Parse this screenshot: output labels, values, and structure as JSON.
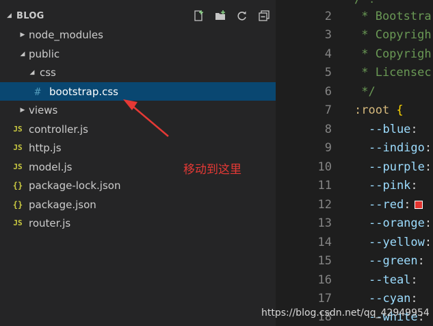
{
  "explorer": {
    "section_title": "BLOG",
    "actions": [
      {
        "name": "new-file-icon"
      },
      {
        "name": "new-folder-icon"
      },
      {
        "name": "refresh-icon"
      },
      {
        "name": "collapse-all-icon"
      }
    ],
    "tree": [
      {
        "label": "node_modules",
        "type": "folder",
        "expanded": false,
        "depth": 1
      },
      {
        "label": "public",
        "type": "folder",
        "expanded": true,
        "depth": 1
      },
      {
        "label": "css",
        "type": "folder",
        "expanded": true,
        "depth": 2
      },
      {
        "label": "bootstrap.css",
        "type": "file",
        "icon": "#",
        "depth": 3,
        "selected": true
      },
      {
        "label": "views",
        "type": "folder",
        "expanded": false,
        "depth": 1
      },
      {
        "label": "controller.js",
        "type": "file",
        "icon": "JS",
        "depth": 0
      },
      {
        "label": "http.js",
        "type": "file",
        "icon": "JS",
        "depth": 0
      },
      {
        "label": "model.js",
        "type": "file",
        "icon": "JS",
        "depth": 0
      },
      {
        "label": "package-lock.json",
        "type": "file",
        "icon": "{}",
        "depth": 0
      },
      {
        "label": "package.json",
        "type": "file",
        "icon": "{}",
        "depth": 0
      },
      {
        "label": "router.js",
        "type": "file",
        "icon": "JS",
        "depth": 0
      }
    ]
  },
  "editor": {
    "lines": [
      {
        "n": "2",
        "text": " * Bootstra",
        "cls": "cmt"
      },
      {
        "n": "3",
        "text": " * Copyrigh",
        "cls": "cmt"
      },
      {
        "n": "4",
        "text": " * Copyrigh",
        "cls": "cmt"
      },
      {
        "n": "5",
        "text": " * Licensec",
        "cls": "cmt"
      },
      {
        "n": "6",
        "text": " */",
        "cls": "cmt"
      },
      {
        "n": "7",
        "sel": ":root",
        "brace": " {"
      },
      {
        "n": "8",
        "prop": "--blue",
        "punc": ":"
      },
      {
        "n": "9",
        "prop": "--indigo",
        "punc": ":"
      },
      {
        "n": "10",
        "prop": "--purple",
        "punc": ":"
      },
      {
        "n": "11",
        "prop": "--pink",
        "punc": ":"
      },
      {
        "n": "12",
        "prop": "--red",
        "punc": ":",
        "swatch": "#e3342f"
      },
      {
        "n": "13",
        "prop": "--orange",
        "punc": ":"
      },
      {
        "n": "14",
        "prop": "--yellow",
        "punc": ":"
      },
      {
        "n": "15",
        "prop": "--green",
        "punc": ":"
      },
      {
        "n": "16",
        "prop": "--teal",
        "punc": ":"
      },
      {
        "n": "17",
        "prop": "--cyan",
        "punc": ":"
      },
      {
        "n": "18",
        "prop": "--white",
        "punc": ":"
      }
    ]
  },
  "annotation": {
    "text": "移动到这里",
    "color": "#e53935"
  },
  "watermark": "https://blog.csdn.net/qq_42949954",
  "colors": {
    "sidebar_bg": "#252526",
    "selected_bg": "#094771",
    "editor_bg": "#1e1e1e"
  }
}
